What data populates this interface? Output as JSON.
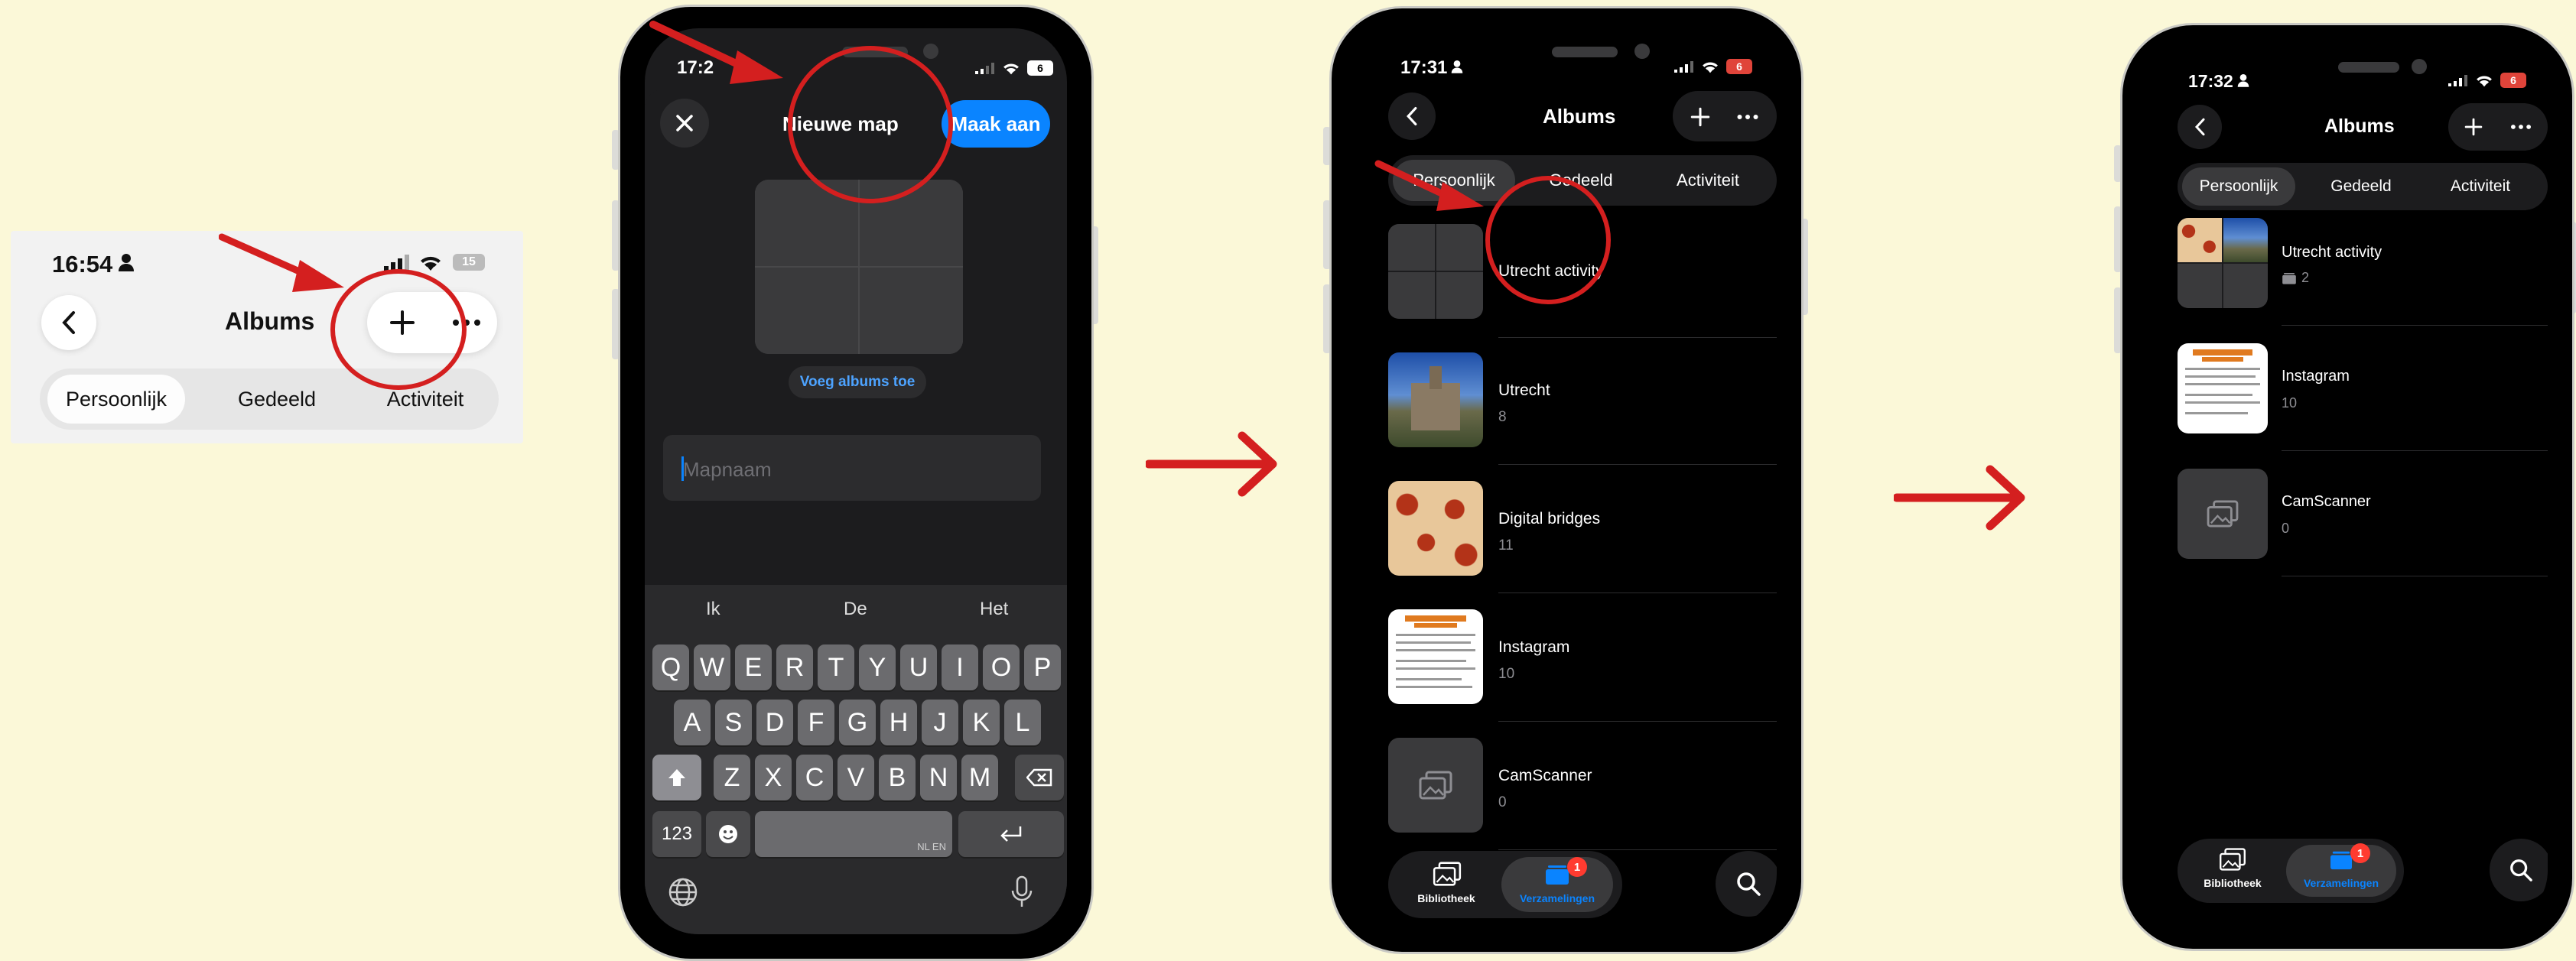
{
  "colors": {
    "background": "#fbf8d8",
    "annotation_red": "#d41f1f",
    "accent_blue": "#0a84ff",
    "badge_red": "#ff3b30"
  },
  "panel1": {
    "time": "16:54",
    "battery": "15",
    "title": "Albums",
    "tabs": [
      "Persoonlijk",
      "Gedeeld",
      "Activiteit"
    ]
  },
  "panel2": {
    "time": "17:2",
    "battery": "6",
    "title": "Nieuwe map",
    "create_label": "Maak aan",
    "add_albums_label": "Voeg albums toe",
    "name_placeholder": "Mapnaam",
    "suggestions": [
      "Ik",
      "De",
      "Het"
    ],
    "row1": [
      "Q",
      "W",
      "E",
      "R",
      "T",
      "Y",
      "U",
      "I",
      "O",
      "P"
    ],
    "row2": [
      "A",
      "S",
      "D",
      "F",
      "G",
      "H",
      "J",
      "K",
      "L"
    ],
    "row3": [
      "Z",
      "X",
      "C",
      "V",
      "B",
      "N",
      "M"
    ],
    "numbers_key": "123",
    "space_hint": "NL EN"
  },
  "panel3": {
    "time": "17:31",
    "battery": "6",
    "title": "Albums",
    "tabs": [
      "Persoonlijk",
      "Gedeeld",
      "Activiteit"
    ],
    "albums": [
      {
        "name": "Utrecht activity",
        "count": ""
      },
      {
        "name": "Utrecht",
        "count": "8"
      },
      {
        "name": "Digital bridges",
        "count": "11"
      },
      {
        "name": "Instagram",
        "count": "10"
      },
      {
        "name": "CamScanner",
        "count": "0"
      }
    ],
    "bottom_nav": {
      "library": "Bibliotheek",
      "collections": "Verzamelingen",
      "badge": "1"
    }
  },
  "panel4": {
    "time": "17:32",
    "battery": "6",
    "title": "Albums",
    "tabs": [
      "Persoonlijk",
      "Gedeeld",
      "Activiteit"
    ],
    "albums": [
      {
        "name": "Utrecht activity",
        "count": "2"
      },
      {
        "name": "Instagram",
        "count": "10"
      },
      {
        "name": "CamScanner",
        "count": "0"
      }
    ],
    "bottom_nav": {
      "library": "Bibliotheek",
      "collections": "Verzamelingen",
      "badge": "1"
    }
  }
}
